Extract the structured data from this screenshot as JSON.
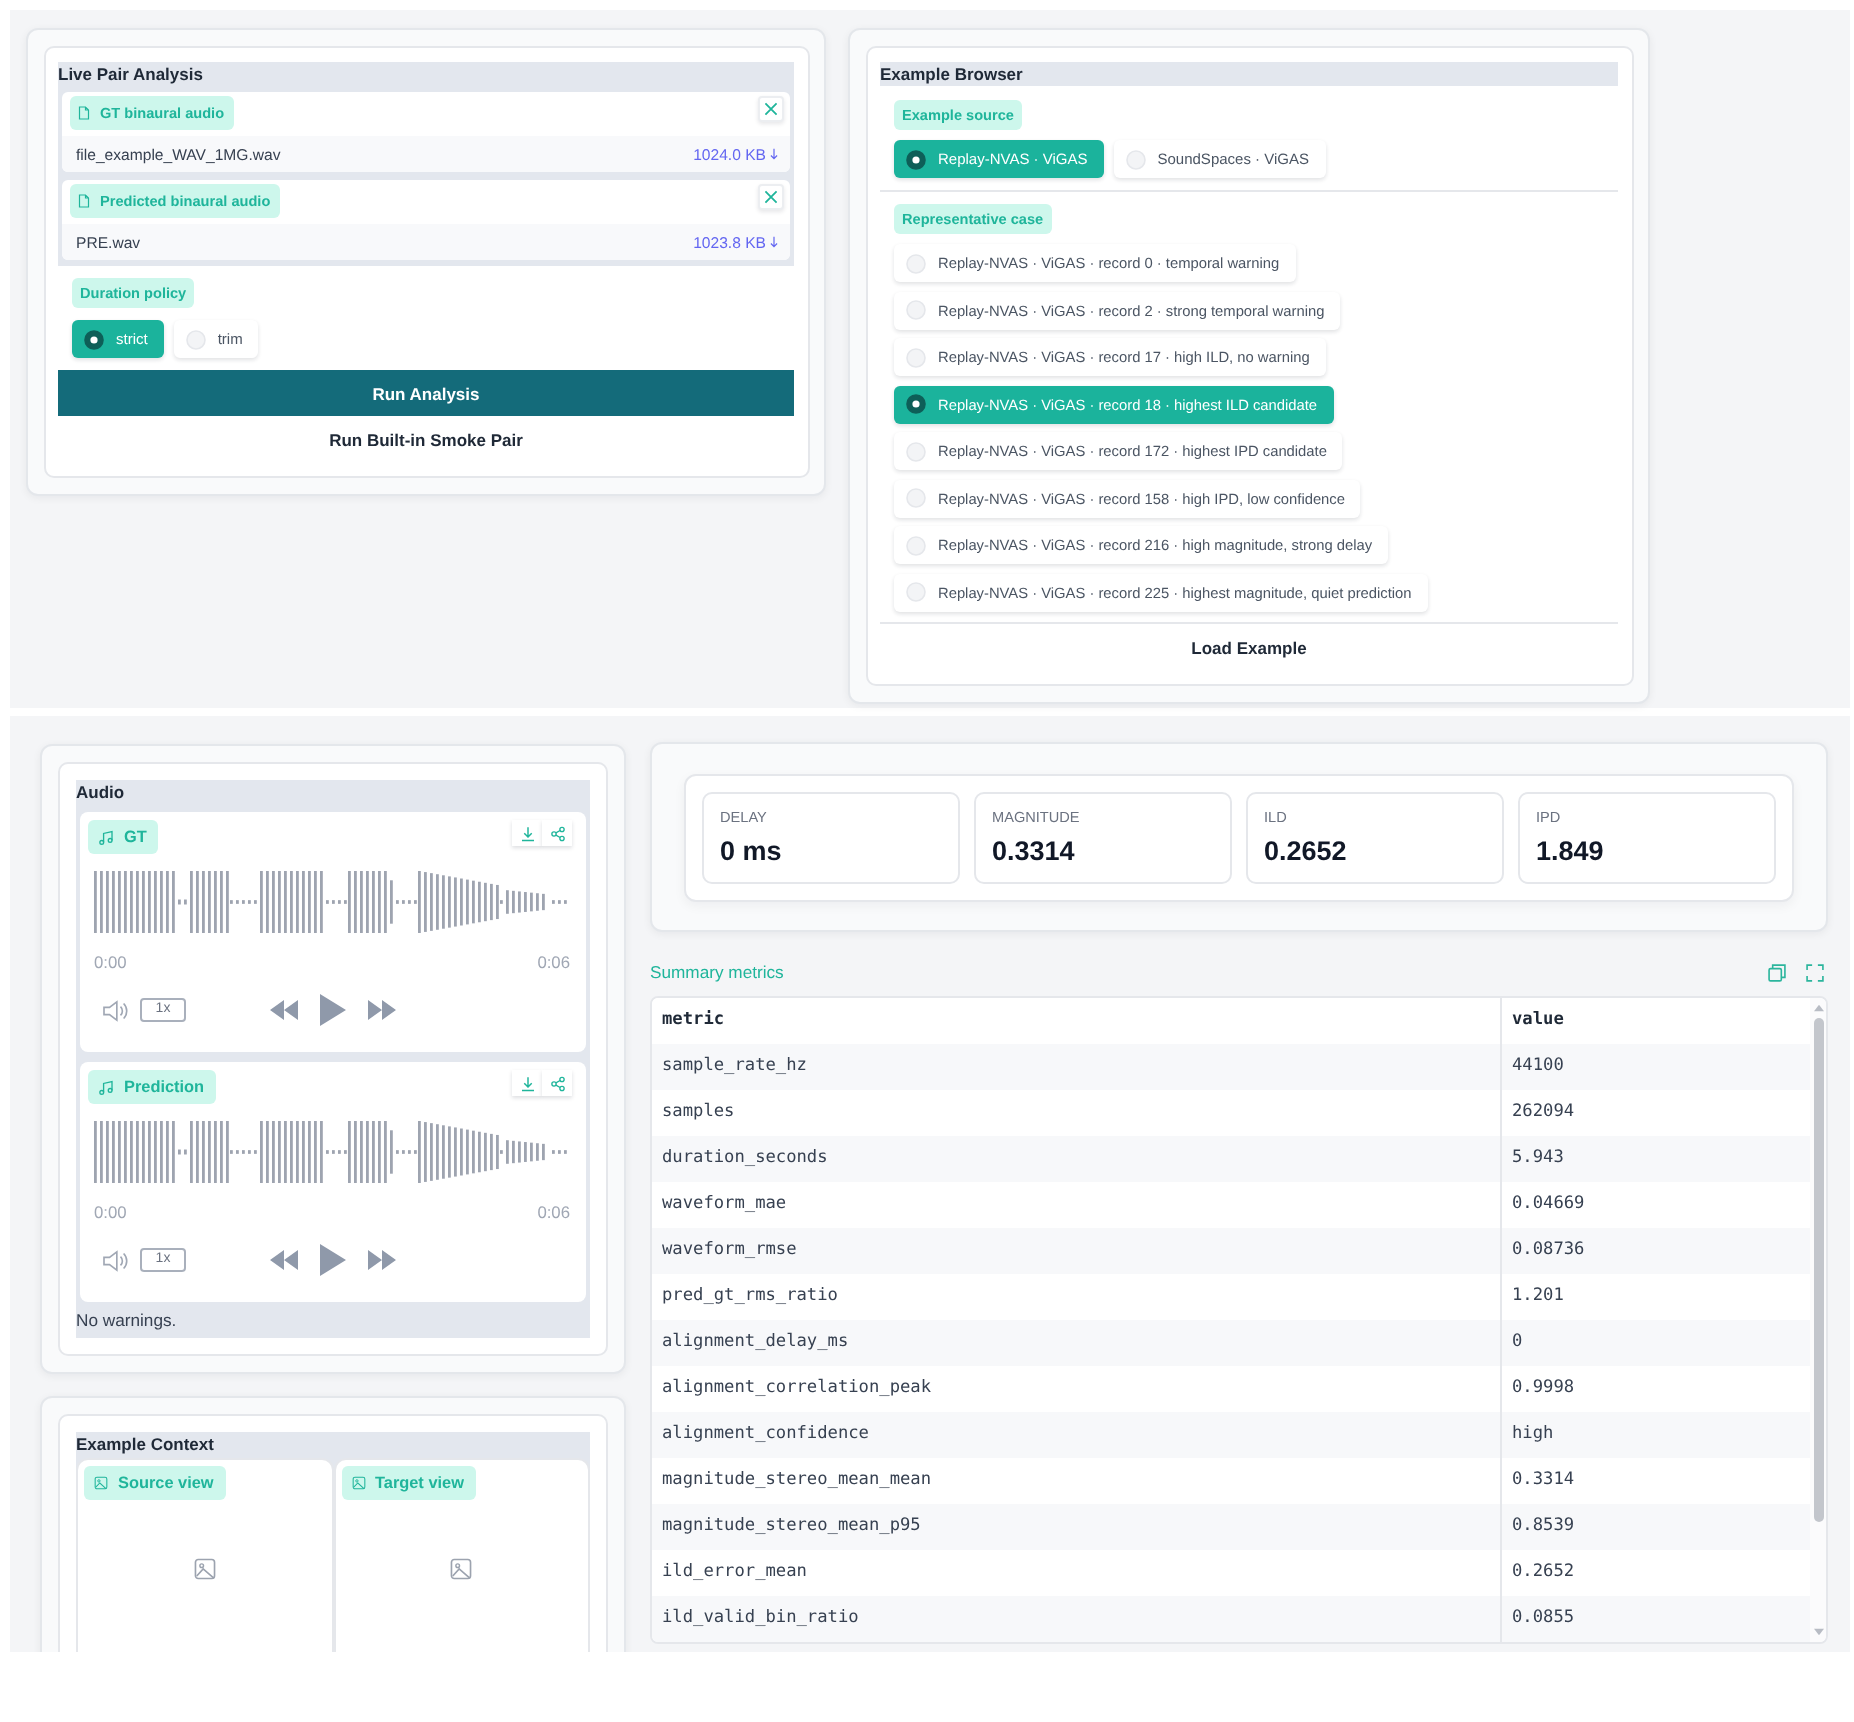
{
  "live_pair_analysis": {
    "title": "Live Pair Analysis",
    "uploads": [
      {
        "label": "GT binaural audio",
        "filename": "file_example_WAV_1MG.wav",
        "size": "1024.0 KB"
      },
      {
        "label": "Predicted binaural audio",
        "filename": "PRE.wav",
        "size": "1023.8 KB"
      }
    ],
    "duration_policy": {
      "label": "Duration policy",
      "options": [
        {
          "label": "strict",
          "selected": true
        },
        {
          "label": "trim",
          "selected": false
        }
      ]
    },
    "buttons": [
      {
        "label": "Run Analysis",
        "kind": "primary"
      },
      {
        "label": "Run Built-in Smoke Pair",
        "kind": "secondary"
      }
    ]
  },
  "example_browser": {
    "title": "Example Browser",
    "source": {
      "label": "Example source",
      "options": [
        {
          "label": "Replay-NVAS · ViGAS",
          "selected": true
        },
        {
          "label": "SoundSpaces · ViGAS",
          "selected": false
        }
      ]
    },
    "cases": {
      "label": "Representative case",
      "options": [
        {
          "label": "Replay-NVAS · ViGAS · record 0 · temporal warning",
          "selected": false
        },
        {
          "label": "Replay-NVAS · ViGAS · record 2 · strong temporal warning",
          "selected": false
        },
        {
          "label": "Replay-NVAS · ViGAS · record 17 · high ILD, no warning",
          "selected": false
        },
        {
          "label": "Replay-NVAS · ViGAS · record 18 · highest ILD candidate",
          "selected": true
        },
        {
          "label": "Replay-NVAS · ViGAS · record 172 · highest IPD candidate",
          "selected": false
        },
        {
          "label": "Replay-NVAS · ViGAS · record 158 · high IPD, low confidence",
          "selected": false
        },
        {
          "label": "Replay-NVAS · ViGAS · record 216 · high magnitude, strong delay",
          "selected": false
        },
        {
          "label": "Replay-NVAS · ViGAS · record 225 · highest magnitude, quiet prediction",
          "selected": false
        }
      ]
    },
    "button": "Load Example"
  },
  "audio": {
    "title": "Audio",
    "players": [
      {
        "label": "GT",
        "start_time": "0:00",
        "end_time": "0:06",
        "speed": "1x"
      },
      {
        "label": "Prediction",
        "start_time": "0:00",
        "end_time": "0:06",
        "speed": "1x"
      }
    ],
    "note": "No warnings."
  },
  "metrics": [
    {
      "label": "DELAY",
      "value": "0 ms"
    },
    {
      "label": "MAGNITUDE",
      "value": "0.3314"
    },
    {
      "label": "ILD",
      "value": "0.2652"
    },
    {
      "label": "IPD",
      "value": "1.849"
    }
  ],
  "summary_metrics": {
    "label": "Summary metrics",
    "columns": [
      "metric",
      "value"
    ],
    "rows": [
      [
        "sample_rate_hz",
        "44100"
      ],
      [
        "samples",
        "262094"
      ],
      [
        "duration_seconds",
        "5.943"
      ],
      [
        "waveform_mae",
        "0.04669"
      ],
      [
        "waveform_rmse",
        "0.08736"
      ],
      [
        "pred_gt_rms_ratio",
        "1.201"
      ],
      [
        "alignment_delay_ms",
        "0"
      ],
      [
        "alignment_correlation_peak",
        "0.9998"
      ],
      [
        "alignment_confidence",
        "high"
      ],
      [
        "magnitude_stereo_mean_mean",
        "0.3314"
      ],
      [
        "magnitude_stereo_mean_p95",
        "0.8539"
      ],
      [
        "ild_error_mean",
        "0.2652"
      ],
      [
        "ild_valid_bin_ratio",
        "0.0855"
      ]
    ]
  },
  "example_context": {
    "title": "Example Context",
    "views": [
      {
        "label": "Source view"
      },
      {
        "label": "Target view"
      }
    ]
  }
}
